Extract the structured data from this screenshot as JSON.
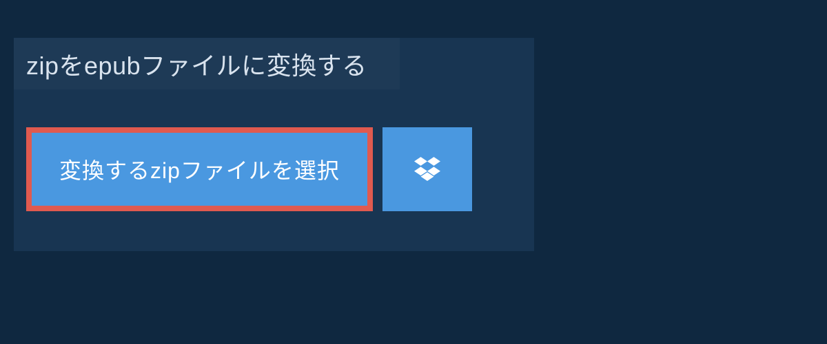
{
  "header": {
    "title": "zipをepubファイルに変換する"
  },
  "actions": {
    "select_label": "変換するzipファイルを選択"
  },
  "colors": {
    "page_bg": "#0f2840",
    "card_bg": "#183552",
    "heading_bg": "#1e3a56",
    "button_bg": "#4a98e0",
    "button_border": "#e05a4f",
    "text_light": "#ffffff",
    "heading_text": "#d9e3ee"
  }
}
